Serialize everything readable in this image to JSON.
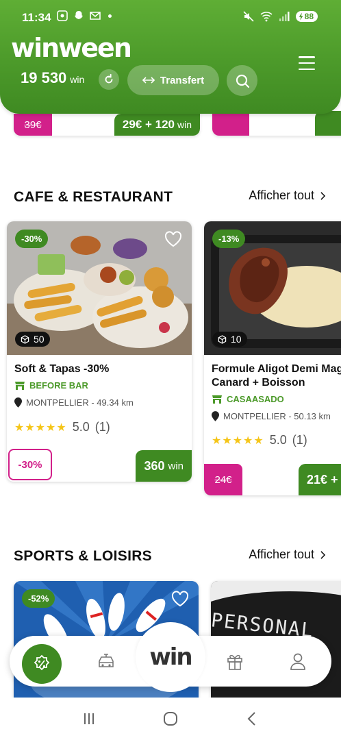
{
  "status_bar": {
    "time": "11:34",
    "battery": "88"
  },
  "header": {
    "logo": "winween",
    "balance_value": "19 530",
    "balance_unit": "win",
    "transfer_label": "Transfert"
  },
  "top_partial": {
    "card1": {
      "old_price": "39€",
      "price": "29€ + 120",
      "price_unit": "win"
    }
  },
  "sections": {
    "cafe": {
      "title": "CAFE & RESTAURANT",
      "see_all": "Afficher tout",
      "cards": [
        {
          "discount": "-30%",
          "stock": "50",
          "title": "Soft & Tapas -30%",
          "vendor": "BEFORE BAR",
          "location": "MONTPELLIER - 49.34 km",
          "rating": "5.0",
          "reviews": "(1)",
          "discount_tag": "-30%",
          "price": "360",
          "price_unit": "win"
        },
        {
          "discount": "-13%",
          "stock": "10",
          "title_line1": "Formule Aligot Demi Mag",
          "title_line2": "Canard + Boisson",
          "vendor": "CASAASADO",
          "location": "MONTPELLIER - 50.13 km",
          "rating": "5.0",
          "reviews": "(1)",
          "old_price": "24€",
          "price": "21€ +"
        }
      ]
    },
    "sports": {
      "title": "SPORTS & LOISIRS",
      "see_all": "Afficher tout",
      "cards": [
        {
          "discount": "-52%",
          "image_text": ""
        },
        {
          "image_text": "PERSONAL"
        }
      ]
    }
  },
  "bottom_nav": {
    "center_label": "win"
  },
  "colors": {
    "brand_green": "#3f8a22",
    "accent_pink": "#d2208a",
    "star": "#f5c518"
  }
}
